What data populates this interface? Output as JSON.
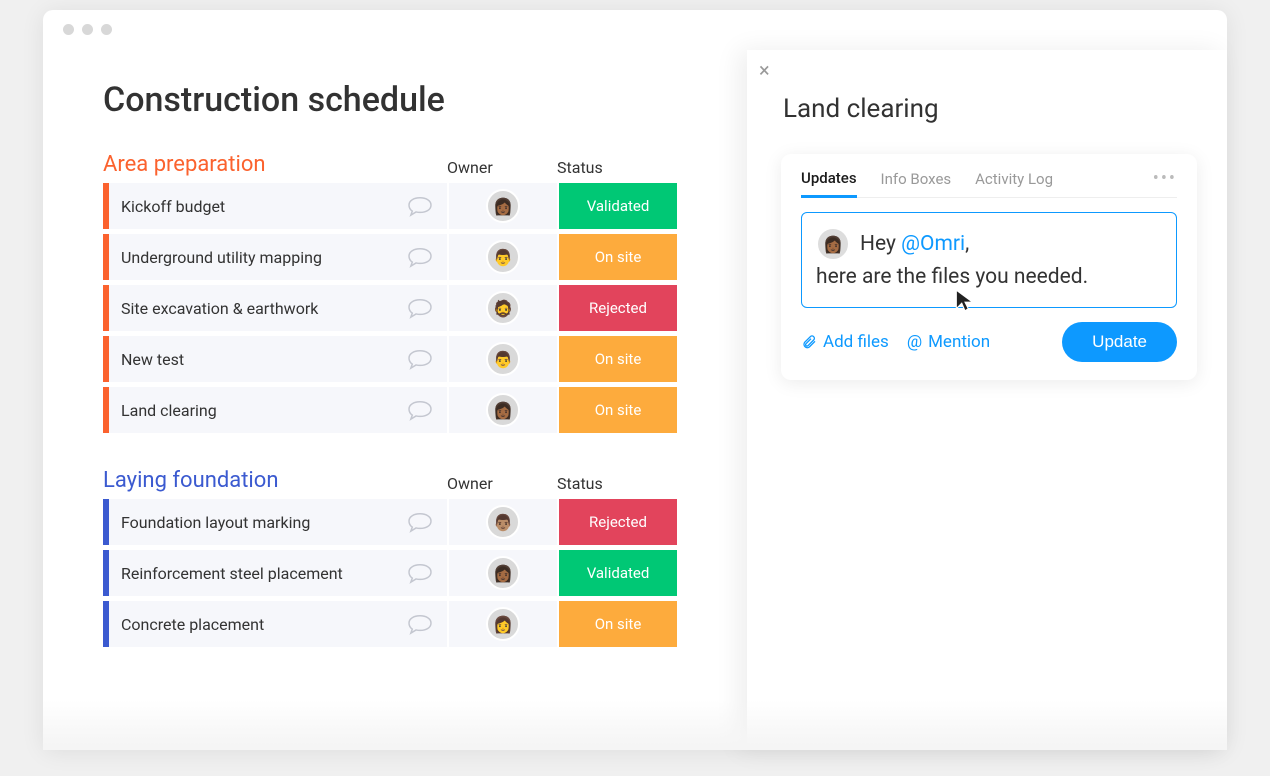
{
  "page": {
    "title": "Construction schedule"
  },
  "columns": {
    "owner": "Owner",
    "status": "Status"
  },
  "statuses": {
    "validated": {
      "label": "Validated",
      "class": "st-validated"
    },
    "onsite": {
      "label": "On site",
      "class": "st-onsite"
    },
    "rejected": {
      "label": "Rejected",
      "class": "st-rejected"
    }
  },
  "sections": [
    {
      "title": "Area preparation",
      "color_class": "orange",
      "stripe_class": "stripe-orange",
      "tasks": [
        {
          "name": "Kickoff budget",
          "owner_initial": "👩🏾",
          "status": "validated"
        },
        {
          "name": "Underground utility mapping",
          "owner_initial": "👨",
          "status": "onsite"
        },
        {
          "name": "Site excavation & earthwork",
          "owner_initial": "🧔",
          "status": "rejected"
        },
        {
          "name": "New test",
          "owner_initial": "👨",
          "status": "onsite"
        },
        {
          "name": "Land clearing",
          "owner_initial": "👩🏾",
          "status": "onsite"
        }
      ]
    },
    {
      "title": "Laying foundation",
      "color_class": "blue",
      "stripe_class": "stripe-blue",
      "tasks": [
        {
          "name": "Foundation layout marking",
          "owner_initial": "👨🏽",
          "status": "rejected"
        },
        {
          "name": "Reinforcement steel placement",
          "owner_initial": "👩🏾",
          "status": "validated"
        },
        {
          "name": "Concrete placement",
          "owner_initial": "👩",
          "status": "onsite"
        }
      ]
    }
  ],
  "panel": {
    "title": "Land clearing",
    "tabs": {
      "updates": "Updates",
      "info": "Info Boxes",
      "activity": "Activity Log"
    },
    "compose": {
      "prefix": "Hey ",
      "mention": "@Omri",
      "suffix": ",",
      "line2": "here are the files you needed.",
      "avatar": "👩🏾"
    },
    "actions": {
      "addFiles": "Add files",
      "mention": "Mention",
      "update": "Update"
    }
  }
}
